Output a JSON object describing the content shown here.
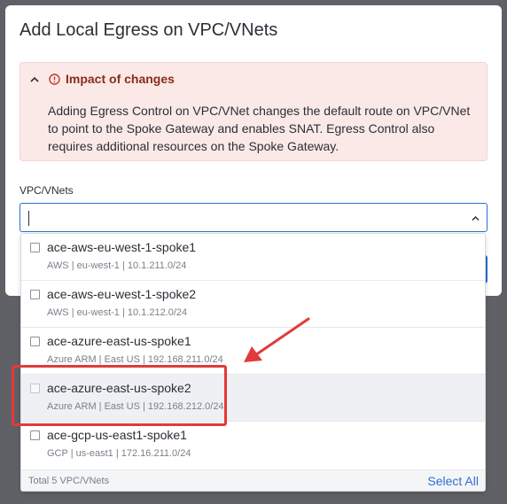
{
  "modal": {
    "title": "Add Local Egress on VPC/VNets"
  },
  "alert": {
    "title": "Impact of changes",
    "body": "Adding Egress Control on VPC/VNet changes the default route on VPC/VNet to point to the Spoke Gateway and enables SNAT. Egress Control also requires additional resources on the Spoke Gateway.",
    "icons": [
      "chevron-up-icon",
      "warning-circle-icon"
    ],
    "color": "#8a2c1b"
  },
  "field": {
    "label": "VPC/VNets",
    "value": ""
  },
  "dropdown": {
    "options": [
      {
        "name": "ace-aws-eu-west-1-spoke1",
        "meta": "AWS | eu-west-1 | 10.1.211.0/24",
        "checked": false
      },
      {
        "name": "ace-aws-eu-west-1-spoke2",
        "meta": "AWS | eu-west-1 | 10.1.212.0/24",
        "checked": false
      },
      {
        "name": "ace-azure-east-us-spoke1",
        "meta": "Azure ARM | East US | 192.168.211.0/24",
        "checked": false
      },
      {
        "name": "ace-azure-east-us-spoke2",
        "meta": "Azure ARM | East US | 192.168.212.0/24",
        "checked": false,
        "hovered": true
      },
      {
        "name": "ace-gcp-us-east1-spoke1",
        "meta": "GCP | us-east1 | 172.16.211.0/24",
        "checked": false
      }
    ],
    "footer_count": "Total 5 VPC/VNets",
    "select_all": "Select All"
  },
  "colors": {
    "accent": "#2e6dd4",
    "annotation": "#e23a3a"
  }
}
